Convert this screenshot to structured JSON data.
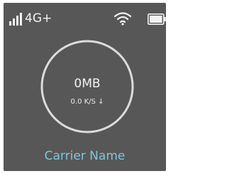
{
  "status_bar": {
    "network_type": "4G+",
    "signal_icon": "signal-bars-icon",
    "wifi_icon": "wifi-icon",
    "battery_icon": "battery-icon"
  },
  "usage": {
    "amount": "0MB",
    "speed": "0.0 K/S ↓"
  },
  "carrier": {
    "name": "Carrier Name"
  },
  "colors": {
    "background": "#575757",
    "foreground": "#f2f2f2",
    "ring": "#dcdcdc",
    "carrier_text": "#7fc7db"
  }
}
